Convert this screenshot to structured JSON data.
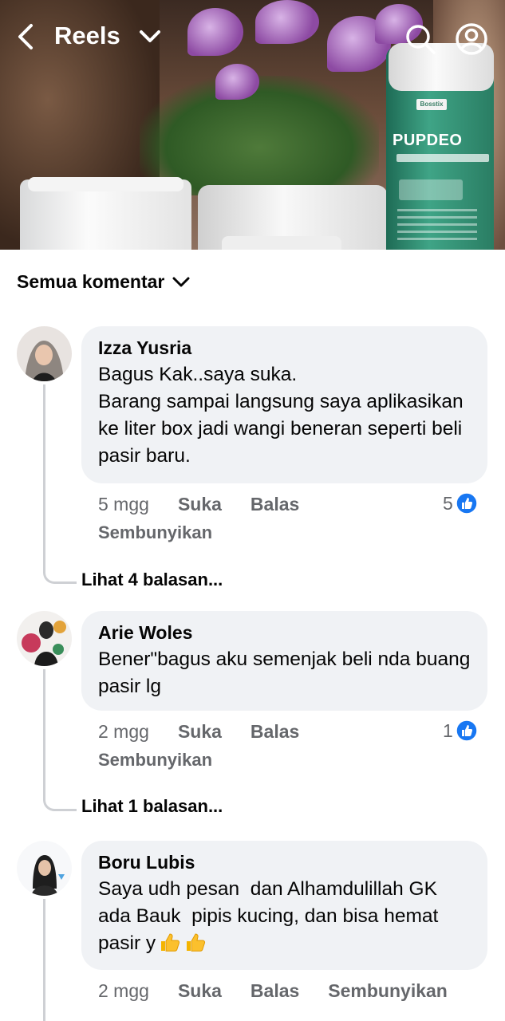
{
  "header": {
    "title": "Reels",
    "product_brand": "PUPDEO",
    "product_badge": "Bosstix"
  },
  "sort": {
    "label": "Semua komentar"
  },
  "comments": [
    {
      "author": "Izza Yusria",
      "text": "Bagus Kak..saya suka.\nBarang sampai langsung saya aplikasikan ke liter box jadi wangi beneran seperti beli pasir baru.",
      "time": "5 mgg",
      "like_label": "Suka",
      "reply_label": "Balas",
      "hide_label": "Sembunyikan",
      "reaction_count": "5",
      "replies_link": "Lihat 4 balasan..."
    },
    {
      "author": "Arie Woles",
      "text": "Bener\"bagus aku semenjak beli nda buang pasir lg",
      "time": "2 mgg",
      "like_label": "Suka",
      "reply_label": "Balas",
      "hide_label": "Sembunyikan",
      "reaction_count": "1",
      "replies_link": "Lihat 1 balasan..."
    },
    {
      "author": "Boru Lubis",
      "text": "Saya udh pesan  dan Alhamdulillah GK ada Bauk  pipis kucing, dan bisa hemat pasir y",
      "emoji": "thumbs-up-emoji x2",
      "time": "2 mgg",
      "like_label": "Suka",
      "reply_label": "Balas",
      "hide_label": "Sembunyikan"
    }
  ],
  "colors": {
    "bubble": "#f0f2f5",
    "secondary_text": "#65676b",
    "like_blue": "#1877f2",
    "thread_line": "#ced0d4"
  }
}
